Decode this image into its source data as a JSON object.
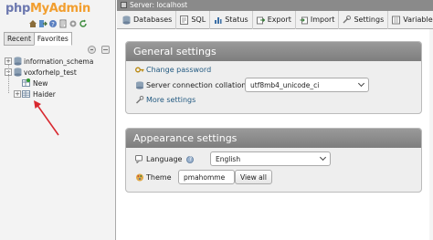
{
  "nav": {
    "logo_part1": "php",
    "logo_part2": "MyAdmin",
    "icons": [
      "home-icon",
      "exit-icon",
      "help-icon",
      "docs-icon",
      "settings-icon",
      "reload-icon"
    ],
    "tabs": [
      "Recent",
      "Favorites"
    ],
    "tree": [
      {
        "label": "information_schema"
      },
      {
        "label": "voxforhelp_test"
      },
      {
        "label": "New"
      },
      {
        "label": "Haider"
      }
    ]
  },
  "topbar": {
    "breadcrumb": "Server: localhost"
  },
  "menu": [
    {
      "label": "Databases",
      "icon": "database-icon"
    },
    {
      "label": "SQL",
      "icon": "sql-icon"
    },
    {
      "label": "Status",
      "icon": "status-icon"
    },
    {
      "label": "Export",
      "icon": "export-icon"
    },
    {
      "label": "Import",
      "icon": "import-icon"
    },
    {
      "label": "Settings",
      "icon": "settings-icon"
    },
    {
      "label": "Variables",
      "icon": "variables-icon"
    }
  ],
  "general": {
    "title": "General settings",
    "change_password": "Change password",
    "collation_label": "Server connection collation:",
    "collation_value": "utf8mb4_unicode_ci",
    "more_settings": "More settings"
  },
  "appearance": {
    "title": "Appearance settings",
    "language_label": "Language",
    "language_value": "English",
    "theme_label": "Theme",
    "theme_value": "pmahomme",
    "view_all": "View all"
  },
  "colors": {
    "link": "#235a81",
    "panel_header": "#8a8a8a",
    "arrow": "#d8282f",
    "logo_php": "#6c78af",
    "logo_myadmin": "#f29e2e"
  }
}
